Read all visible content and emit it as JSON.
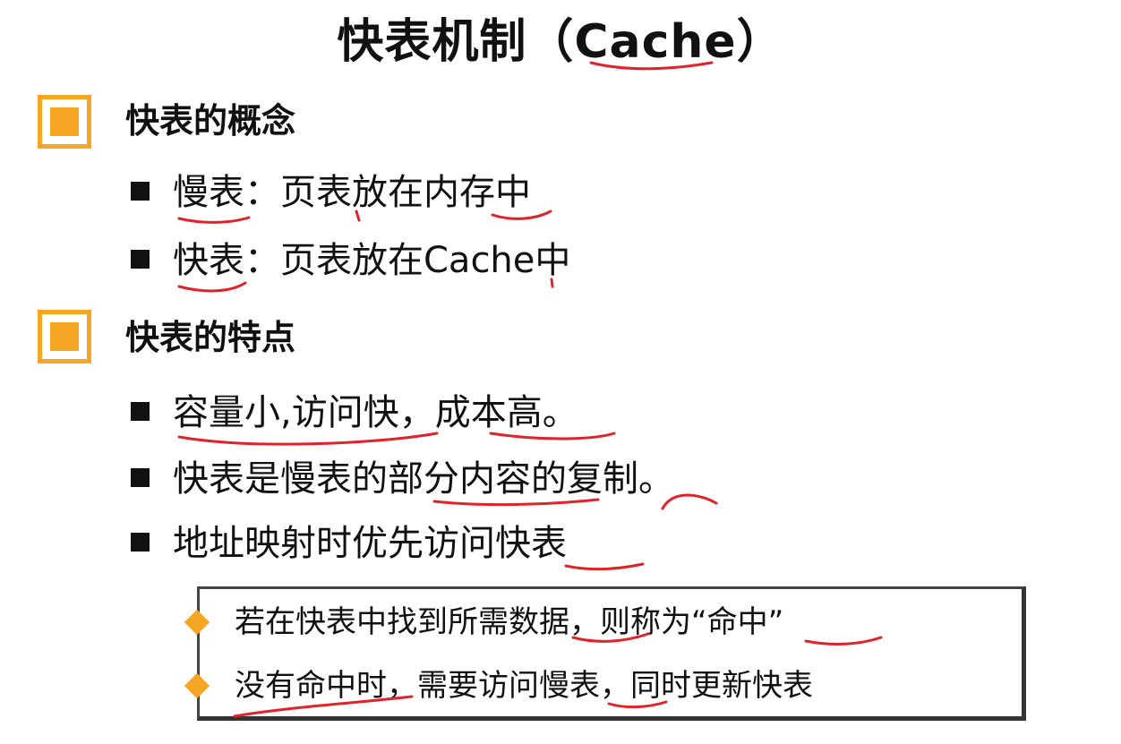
{
  "title": "快表机制（Cache）",
  "sections": [
    {
      "heading": "快表的概念",
      "bullets": [
        "慢表：页表放在内存中",
        "快表：页表放在Cache中"
      ]
    },
    {
      "heading": "快表的特点",
      "bullets": [
        "容量小,访问快，成本高。",
        "快表是慢表的部分内容的复制。",
        "地址映射时优先访问快表"
      ]
    }
  ],
  "callout": {
    "items": [
      "若在快表中找到所需数据，则称为“命中”",
      "没有命中时，需要访问慢表，同时更新快表"
    ]
  },
  "colors": {
    "accent": "#f5a623",
    "annotation": "#e0222a",
    "text": "#111111"
  },
  "icons": {
    "section_marker": "orange-square-icon",
    "bullet": "black-square-bullet-icon",
    "sub_bullet": "orange-diamond-icon"
  }
}
